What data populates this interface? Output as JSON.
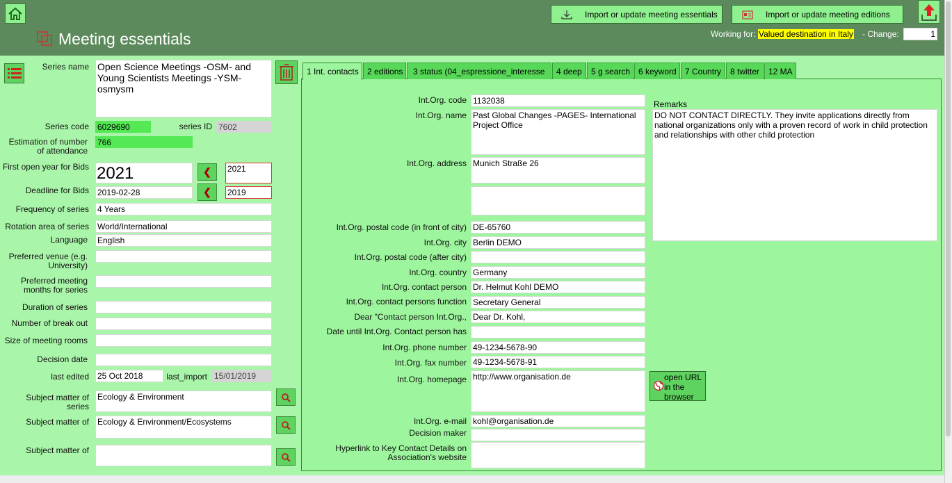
{
  "header": {
    "title": "Meeting essentials",
    "import_essentials_label": "Import or update meeting essentials",
    "import_editions_label": "Import or update meeting editions",
    "working_for_label": "Working for:",
    "working_for_value": "Valued destination in Italy",
    "change_label": "- Change:",
    "change_value": "1"
  },
  "left": {
    "series_name_label": "Series name",
    "series_name_value": "Open Science Meetings -OSM- and Young Scientists Meetings -YSM- osmysm",
    "series_code_label": "Series code",
    "series_code_value": "6029690",
    "series_id_label": "series ID",
    "series_id_value": "7602",
    "attendance_label": "Estimation of number of attendance",
    "attendance_value": "766",
    "first_year_label": "First open year for Bids",
    "first_year_value": "2021",
    "first_year_side": "2021",
    "deadline_label": "Deadline for Bids",
    "deadline_value": "2019-02-28",
    "deadline_side": "2019",
    "frequency_label": "Frequency of series",
    "frequency_value": "4 Years",
    "rotation_label": "Rotation area of series",
    "rotation_value": "World/International",
    "language_label": "Language",
    "language_value": "English",
    "venue_label": "Preferred venue (e.g. University)",
    "venue_value": "",
    "months_label": "Preferred meeting months for series",
    "months_value": "",
    "duration_label": "Duration of series",
    "duration_value": "",
    "breakout_label": "Number of break out",
    "breakout_value": "",
    "rooms_label": "Size of meeting rooms",
    "rooms_value": "",
    "decision_label": "Decision date",
    "decision_value": "",
    "last_edited_label": "last edited",
    "last_edited_value": "25 Oct 2018",
    "last_import_label": "last_import",
    "last_import_value": "15/01/2019",
    "subject1_label": "Subject matter of series",
    "subject1_value": "Ecology & Environment",
    "subject2_label": "Subject matter of",
    "subject2_value": "Ecology & Environment/Ecosystems",
    "subject3_label": "Subject matter of",
    "subject3_value": ""
  },
  "tabs": [
    {
      "label": "1 Int. contacts"
    },
    {
      "label": "2 editions"
    },
    {
      "label": "3 status (04_espressione_interesse"
    },
    {
      "label": "4 deep"
    },
    {
      "label": "5 g search"
    },
    {
      "label": "6 keyword"
    },
    {
      "label": "7 Country"
    },
    {
      "label": "8 twitter"
    },
    {
      "label": "12 MA"
    }
  ],
  "contacts": {
    "code_label": "Int.Org. code",
    "code_value": "1132038",
    "name_label": "Int.Org. name",
    "name_value": "Past Global Changes -PAGES- International Project Office",
    "address_label": "Int.Org. address",
    "address_value": "Munich Straße 26",
    "address2_value": "",
    "postal_front_label": "Int.Org. postal code (in front of city)",
    "postal_front_value": "DE-65760",
    "city_label": "Int.Org. city",
    "city_value": "Berlin DEMO",
    "postal_after_label": "Int.Org. postal code (after city)",
    "postal_after_value": "",
    "country_label": "Int.Org. country",
    "country_value": "Germany",
    "person_label": "Int.Org. contact person",
    "person_value": "Dr. Helmut Kohl DEMO",
    "function_label": "Int.Org. contact persons function",
    "function_value": "Secretary General",
    "dear_label": "Dear \"Contact person Int.Org.,",
    "dear_value": "Dear Dr. Kohl,",
    "date_until_label": "Date until Int.Org. Contact person has",
    "date_until_value": "",
    "phone_label": "Int.Org. phone number",
    "phone_value": "49-1234-5678-90",
    "fax_label": "Int.Org. fax number",
    "fax_value": "49-1234-5678-91",
    "homepage_label": "Int.Org. homepage",
    "homepage_value": "http://www.organisation.de",
    "open_url_label": "open URL in the browser",
    "email_label": "Int.Org. e-mail",
    "email_value": "kohl@organisation.de",
    "decision_maker_label": "Decision maker",
    "decision_maker_value": "",
    "hyperlink_label": "Hyperlink to Key Contact Details on Association's website",
    "hyperlink_value": "",
    "remarks_label": "Remarks",
    "remarks_value": "DO NOT CONTACT  DIRECTLY. They invite applications directly from national organizations only with a proven record of work in child protection and relationships with other child protection"
  },
  "colors": {
    "header_bg": "#5c8a5c",
    "page_bg": "#a9f5a9",
    "panel_bg": "#9df59d",
    "accent_green": "#54e854",
    "highlight_yellow": "#ffff00"
  }
}
